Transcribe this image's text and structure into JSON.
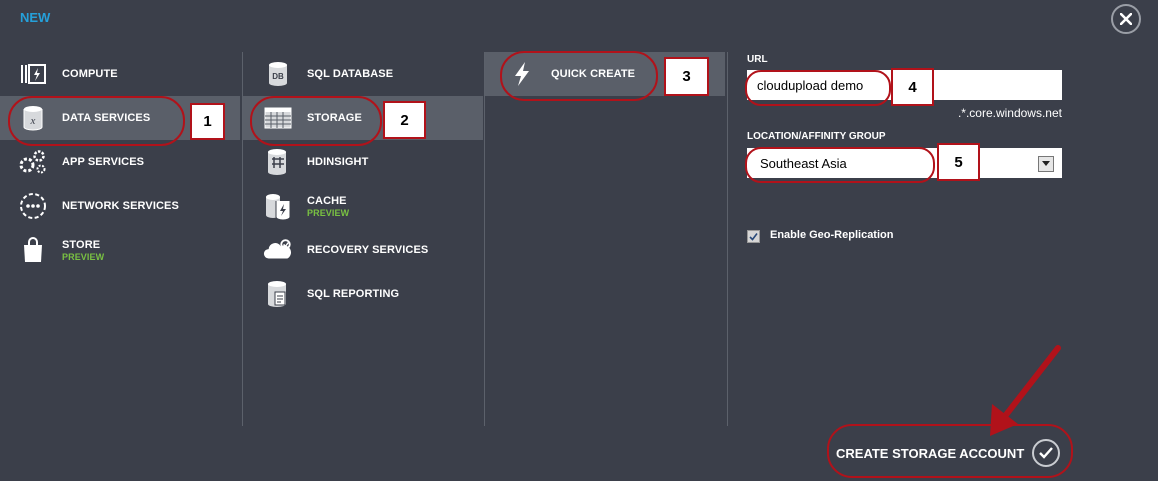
{
  "header": {
    "title": "NEW"
  },
  "col1": [
    {
      "label": "COMPUTE",
      "icon": "compute-icon"
    },
    {
      "label": "DATA SERVICES",
      "icon": "data-services-icon"
    },
    {
      "label": "APP SERVICES",
      "icon": "app-services-icon"
    },
    {
      "label": "NETWORK SERVICES",
      "icon": "network-services-icon"
    },
    {
      "label": "STORE",
      "sub": "PREVIEW",
      "icon": "store-icon"
    }
  ],
  "col2": [
    {
      "label": "SQL DATABASE",
      "icon": "sql-database-icon"
    },
    {
      "label": "STORAGE",
      "icon": "storage-icon"
    },
    {
      "label": "HDINSIGHT",
      "icon": "hdinsight-icon"
    },
    {
      "label": "CACHE",
      "sub": "PREVIEW",
      "icon": "cache-icon"
    },
    {
      "label": "RECOVERY SERVICES",
      "icon": "recovery-services-icon"
    },
    {
      "label": "SQL REPORTING",
      "icon": "sql-reporting-icon"
    }
  ],
  "col3": [
    {
      "label": "QUICK CREATE",
      "icon": "lightning-icon"
    }
  ],
  "form": {
    "url_label": "URL",
    "url_value": "cloudupload demo",
    "url_suffix": ".*.core.windows.net",
    "location_label": "LOCATION/AFFINITY GROUP",
    "location_value": "Southeast Asia",
    "geo_label": "Enable Geo-Replication",
    "geo_checked": true
  },
  "annotations": [
    "1",
    "2",
    "3",
    "4",
    "5"
  ],
  "footer": {
    "create_label": "CREATE STORAGE ACCOUNT"
  },
  "colors": {
    "background": "#3b3f4a",
    "selected": "#5a5f69",
    "accent": "#25a0da",
    "preview": "#79c142",
    "annotation": "#b1121a"
  }
}
